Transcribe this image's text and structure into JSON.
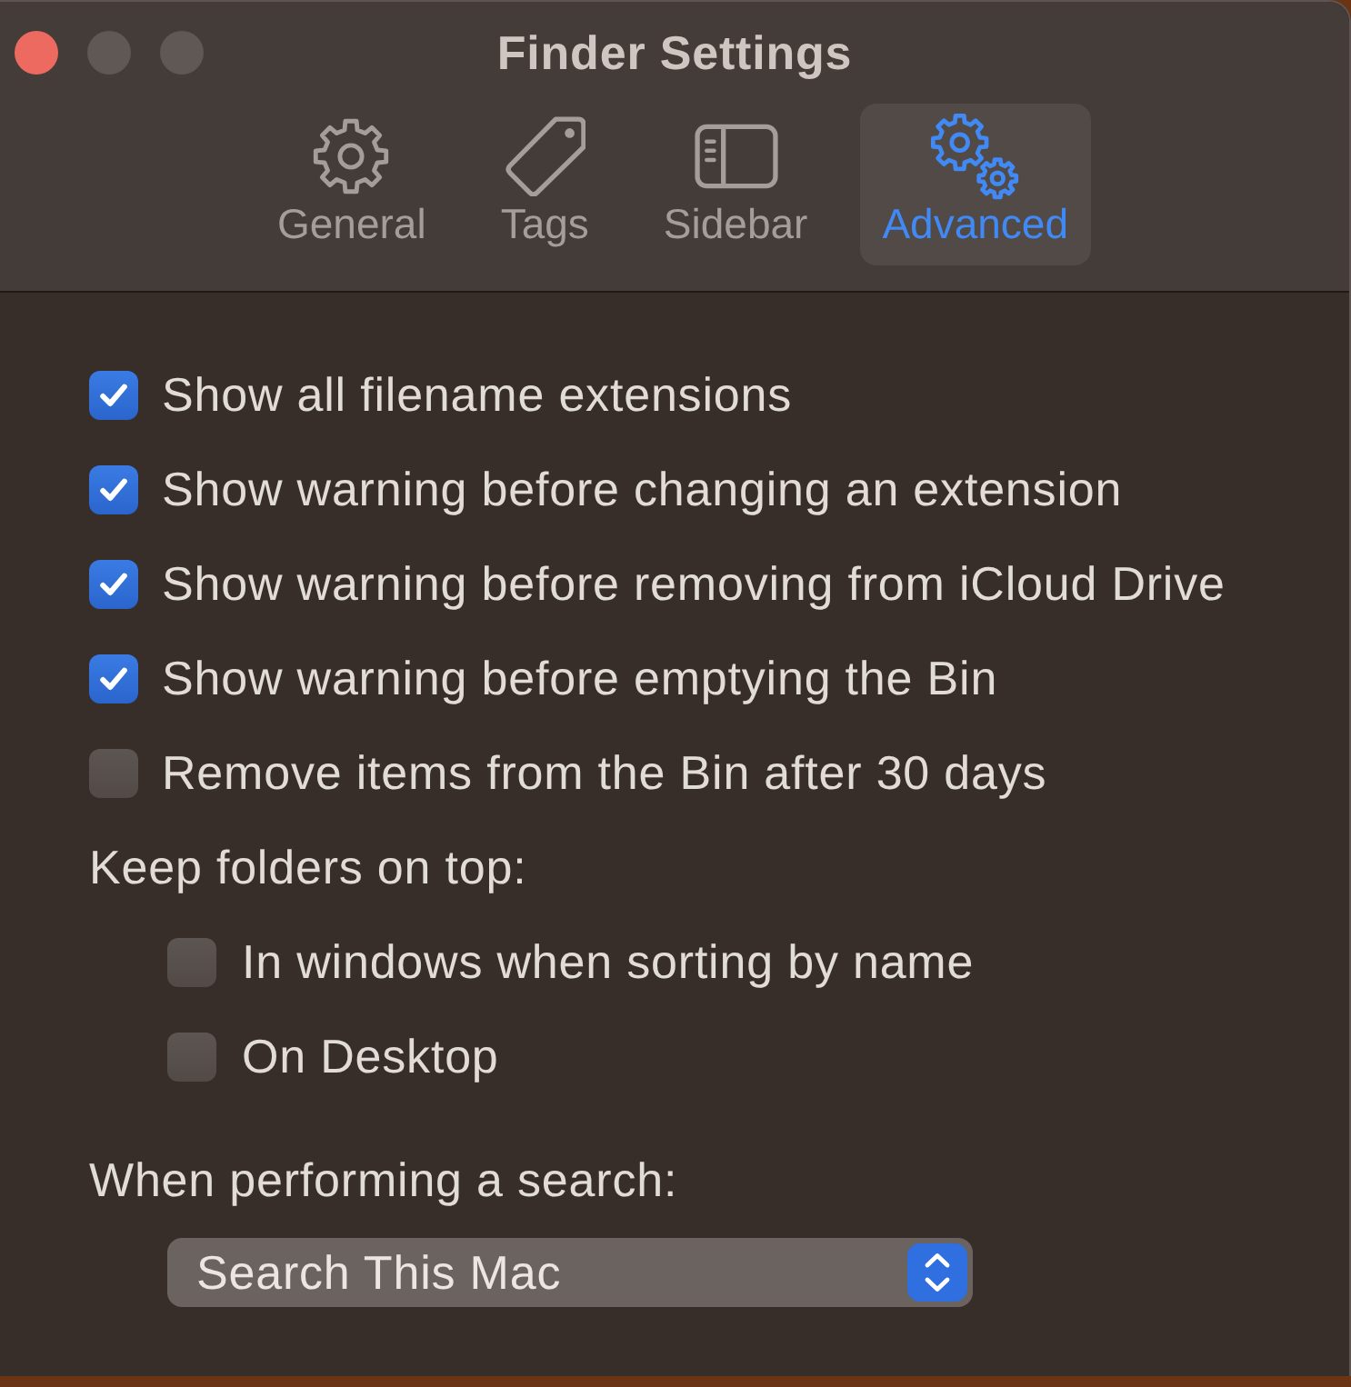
{
  "window": {
    "title": "Finder Settings",
    "buttons": [
      {
        "kind": "close",
        "disabled": false
      },
      {
        "kind": "minimize",
        "disabled": true
      },
      {
        "kind": "zoom",
        "disabled": true
      }
    ]
  },
  "tabs": [
    {
      "kind": "general",
      "label": "General",
      "selected": false
    },
    {
      "kind": "tags",
      "label": "Tags",
      "selected": false
    },
    {
      "kind": "sidebar",
      "label": "Sidebar",
      "selected": false
    },
    {
      "kind": "advanced",
      "label": "Advanced",
      "selected": true
    }
  ],
  "options": [
    {
      "label": "Show all filename extensions",
      "checked": true
    },
    {
      "label": "Show warning before changing an extension",
      "checked": true
    },
    {
      "label": "Show warning before removing from iCloud Drive",
      "checked": true
    },
    {
      "label": "Show warning before emptying the Bin",
      "checked": true
    },
    {
      "label": "Remove items from the Bin after 30 days",
      "checked": false
    }
  ],
  "keep_folders_on_top": {
    "label": "Keep folders on top:",
    "options": [
      {
        "label": "In windows when sorting by name",
        "checked": false
      },
      {
        "label": "On Desktop",
        "checked": false
      }
    ]
  },
  "search": {
    "label": "When performing a search:",
    "value": "Search This Mac"
  }
}
